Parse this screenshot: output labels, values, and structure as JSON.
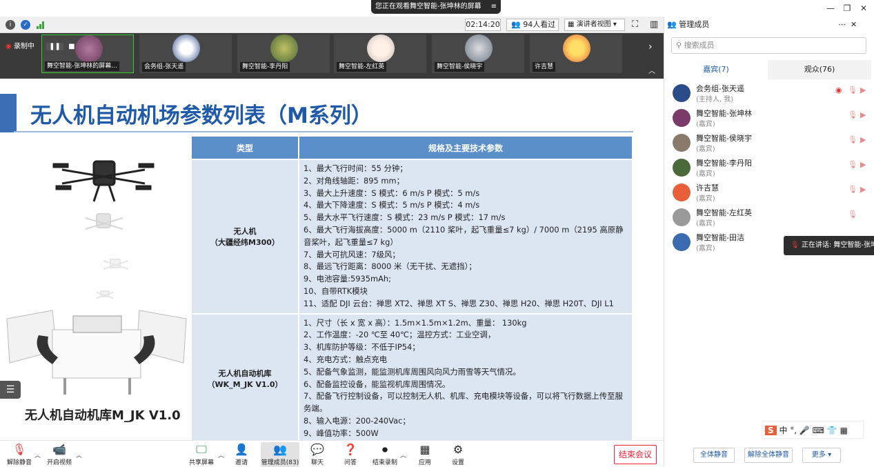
{
  "titlebar": {
    "share_notice": "您正在观看舞空智能-张坤林的屏幕",
    "minimize": "—",
    "restore": "❐",
    "close": "✕"
  },
  "meetbar": {
    "timer": "02:14:20",
    "viewers": "94人看过",
    "viewmode": "演讲者视图 ▾"
  },
  "strip": {
    "recording_label": "录制中",
    "tiles": [
      {
        "name": "舞空智能-张坤林的屏幕..."
      },
      {
        "name": "会务组-张天遥"
      },
      {
        "name": "舞空智能-李丹阳"
      },
      {
        "name": "舞空智能-左红英"
      },
      {
        "name": "舞空智能-侯晓宇"
      },
      {
        "name": "许吉慧"
      }
    ]
  },
  "slide": {
    "title": "无人机自动机场参数列表（M系列）",
    "col_type": "类型",
    "col_spec": "规格及主要技术参数",
    "rows": [
      {
        "type": "无人机\n（大疆经纬M300）",
        "specs": [
          "1、最大飞行时间：55 分钟；",
          "2、对角线轴距：895 mm；",
          "3、最大上升速度：S 模式：6 m/s P 模式：5 m/s",
          "4、最大下降速度：S 模式：5 m/s P 模式：4 m/s",
          "5、最大水平飞行速度：S 模式：23 m/s  P 模式：17 m/s",
          "6、最大飞行海拔高度：5000 m（2110 桨叶，起飞重量≤7 kg）/ 7000 m（2195 高原静音桨叶，起飞重量≤7 kg）",
          "7、最大可抗风速：7级风；",
          "8、最远飞行距离：8000 米（无干扰、无遮挡）；",
          "9、电池容量:5935mAh;",
          "10、自带RTK模块",
          "11、适配 DJI 云台：禅思 XT2、禅思 XT S、禅思 Z30、禅思 H20、禅思 H20T、DJI L1"
        ]
      },
      {
        "type": "无人机自动机库\n（WK_M_JK V1.0）",
        "specs": [
          "1、尺寸（长 x 宽 x 高）：1.5m×1.5m×1.2m、重量： 130kg",
          "2、工作温度：-20 ℃至 40℃；温控方式：工业空调，",
          "3、机库防护等级：不低于IP54；",
          "4、充电方式：触点充电",
          "5、配备气象监测，能监测机库周围风向风力雨雪等天气情况。",
          "6、配备监控设备，能监视机库周围情况。",
          "7、配备飞行控制设备，可以控制无人机、机库、充电模块等设备，可以将飞行数据上传至服务端。",
          "8、输入电源：200-240Vac；",
          "9、峰值功率：500W"
        ]
      }
    ],
    "product_caption": "无人机自动机库M_JK V1.0"
  },
  "bottombar": {
    "unmute": "解除静音",
    "video": "开启视频",
    "share": "共享屏幕",
    "invite": "邀请",
    "members": "管理成员(83)",
    "chat": "聊天",
    "qa": "问答",
    "stop_record": "结束录制",
    "apps": "应用",
    "settings": "设置",
    "end_meeting": "结束会议"
  },
  "panel": {
    "title": "管理成员",
    "search_placeholder": "搜索成员",
    "tab_guests": "嘉宾(7)",
    "tab_audience": "观众(76)",
    "members": [
      {
        "name": "会务组-张天遥",
        "role": "(主持人, 我)",
        "color": "#2a4d8a"
      },
      {
        "name": "舞空智能-张坤林",
        "role": "(嘉宾)",
        "color": "#7a3a6a"
      },
      {
        "name": "舞空智能-侯晓宇",
        "role": "(嘉宾)",
        "color": "#8a7a6a"
      },
      {
        "name": "舞空智能-李丹阳",
        "role": "(嘉宾)",
        "color": "#4a6a3a"
      },
      {
        "name": "许吉慧",
        "role": "(嘉宾)",
        "color": "#e8603a"
      },
      {
        "name": "舞空智能-左红英",
        "role": "(嘉宾)",
        "color": "#9a9a9a"
      },
      {
        "name": "舞空智能-田洁",
        "role": "(嘉宾)",
        "color": "#3a6ab0"
      }
    ],
    "speaking": "正在讲话: 舞空智能-张坤林",
    "mute_all": "全体静音",
    "unmute_all": "解除全体静音",
    "more": "更多 ▾",
    "ime": "中 °, 🎤 ⌨ 👕 ▦"
  },
  "colors": {
    "accent": "#1e5aa8",
    "header": "#5b8fc9",
    "cell": "#dce6f2",
    "danger": "#e22233"
  }
}
